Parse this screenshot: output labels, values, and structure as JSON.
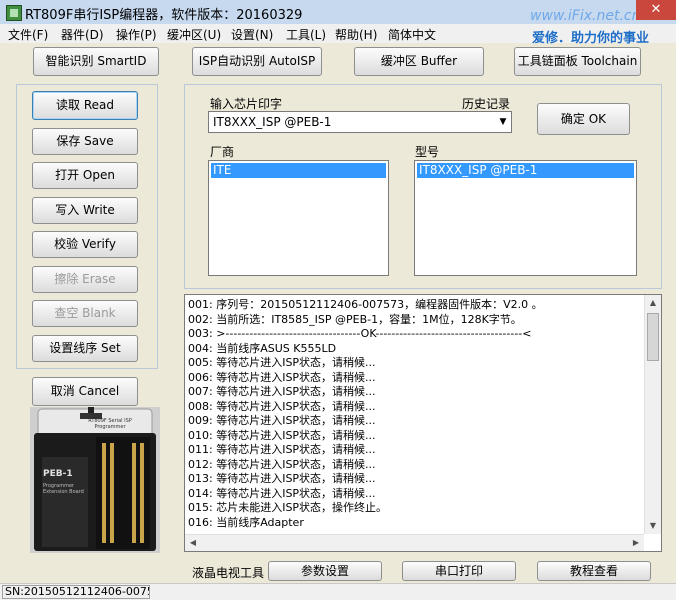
{
  "window": {
    "title": "RT809F串行ISP编程器，软件版本：20160329",
    "close_glyph": "✕"
  },
  "watermark": {
    "url": "www.iFix.net.cn",
    "slogan": "爱修．助力你的事业"
  },
  "menu": [
    "文件(F)",
    "器件(D)",
    "操作(P)",
    "缓冲区(U)",
    "设置(N)",
    "工具(L)",
    "帮助(H)",
    "简体中文"
  ],
  "toolbar": {
    "smartid": "智能识别 SmartID",
    "autoisp": "ISP自动识别 AutoISP",
    "buffer": "缓冲区 Buffer",
    "toolchain": "工具链面板 Toolchain"
  },
  "actions": {
    "read": "读取 Read",
    "save": "保存 Save",
    "open": "打开 Open",
    "write": "写入 Write",
    "verify": "校验 Verify",
    "erase": "擦除 Erase",
    "blank": "查空 Blank",
    "set_pinout": "设置线序 Set",
    "cancel": "取消 Cancel"
  },
  "chip": {
    "input_label": "输入芯片印字",
    "history_label": "历史记录",
    "value": "IT8XXX_ISP @PEB-1",
    "ok": "确定 OK",
    "vendor_label": "厂商",
    "model_label": "型号",
    "vendors": [
      "ITE"
    ],
    "models": [
      "IT8XXX_ISP @PEB-1"
    ]
  },
  "log": {
    "lines": [
      "001: 序列号：20150512112406-007573，编程器固件版本：V2.0 。",
      "002: 当前所选：IT8585_ISP @PEB-1，容量：1M位，128K字节。",
      "003: >----------------------------------OK-------------------------------------<",
      "004: 当前线序ASUS K555LD",
      "005: 等待芯片进入ISP状态，请稍候...",
      "006: 等待芯片进入ISP状态，请稍候...",
      "007: 等待芯片进入ISP状态，请稍候...",
      "008: 等待芯片进入ISP状态，请稍候...",
      "009: 等待芯片进入ISP状态，请稍候...",
      "010: 等待芯片进入ISP状态，请稍候...",
      "011: 等待芯片进入ISP状态，请稍候...",
      "012: 等待芯片进入ISP状态，请稍候...",
      "013: 等待芯片进入ISP状态，请稍候...",
      "014: 等待芯片进入ISP状态，请稍候...",
      "015: 芯片未能进入ISP状态，操作终止。",
      "016: 当前线序Adapter"
    ]
  },
  "bottom": {
    "lcd_tools_label": "液晶电视工具",
    "param_settings": "参数设置",
    "serial_print": "串口打印",
    "tutorial": "教程查看"
  },
  "statusbar": {
    "serial": "SN:20150512112406-0075"
  },
  "device": {
    "brand_text": "RT809F Serial ISP Programmer",
    "board_label": "PEB-1",
    "board_sub": "Programmer Extension Board"
  },
  "colors": {
    "title_bg": "#c6d9ef",
    "client_bg": "#ece9d8",
    "selection": "#3399ff",
    "close_red": "#c9473d"
  }
}
